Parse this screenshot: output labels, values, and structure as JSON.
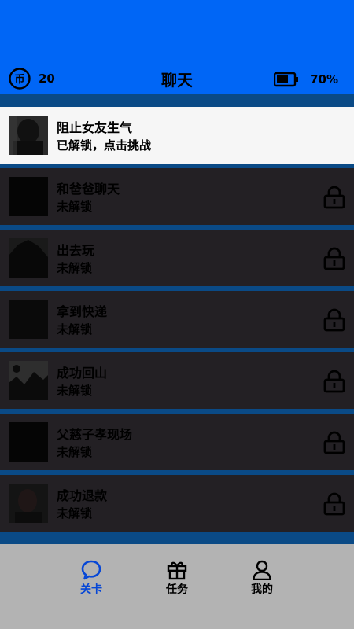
{
  "header": {
    "coins": "20",
    "title": "聊天",
    "battery": "70%",
    "battery_level": 0.7,
    "accent_color": "#0066f6"
  },
  "levels": [
    {
      "name": "阻止女友生气",
      "status": "已解锁，点击挑战",
      "unlocked": true
    },
    {
      "name": "和爸爸聊天",
      "status": "未解锁",
      "unlocked": false
    },
    {
      "name": "出去玩",
      "status": "未解锁",
      "unlocked": false
    },
    {
      "name": "拿到快递",
      "status": "未解锁",
      "unlocked": false
    },
    {
      "name": "成功回山",
      "status": "未解锁",
      "unlocked": false
    },
    {
      "name": "父慈子孝现场",
      "status": "未解锁",
      "unlocked": false
    },
    {
      "name": "成功退款",
      "status": "未解锁",
      "unlocked": false
    }
  ],
  "tabs": [
    {
      "label": "关卡",
      "icon": "chat-bubble-icon",
      "active": true
    },
    {
      "label": "任务",
      "icon": "gift-icon",
      "active": false
    },
    {
      "label": "我的",
      "icon": "person-icon",
      "active": false
    }
  ]
}
